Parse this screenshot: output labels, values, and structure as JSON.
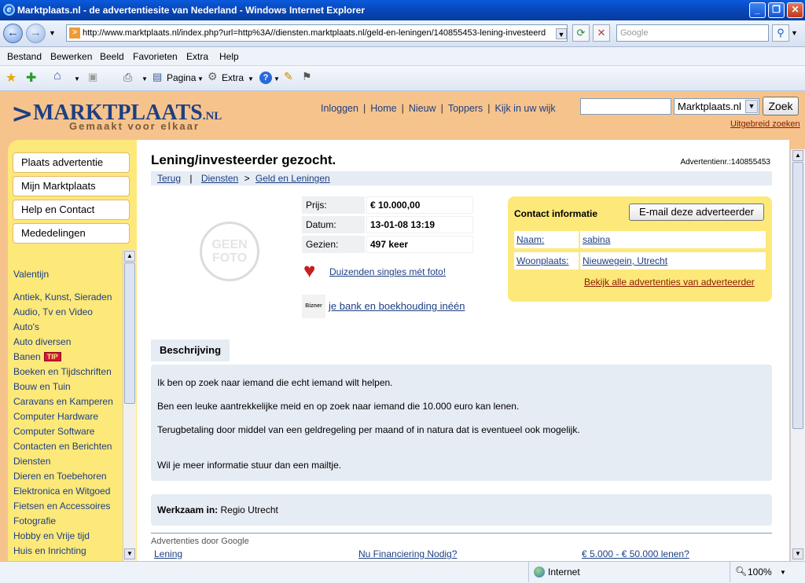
{
  "window": {
    "title": "Marktplaats.nl - de advertentiesite van Nederland - Windows Internet Explorer",
    "address": "http://www.marktplaats.nl/index.php?url=http%3A//diensten.marktplaats.nl/geld-en-leningen/140855453-lening-investeerd",
    "search_placeholder": "Google",
    "menu": [
      "Bestand",
      "Bewerken",
      "Beeld",
      "Favorieten",
      "Extra",
      "Help"
    ],
    "toolbar": {
      "page": "Pagina",
      "extra": "Extra"
    }
  },
  "header": {
    "logo_name": "MARKTPLAATS",
    "logo_tld": ".NL",
    "slogan": "Gemaakt voor elkaar",
    "nav": [
      "Inloggen",
      "Home",
      "Nieuw",
      "Toppers",
      "Kijk in uw wijk"
    ],
    "search_scope": "Marktplaats.nl",
    "search_button": "Zoek",
    "advanced_search": "Uitgebreid zoeken"
  },
  "sidebar": {
    "buttons": [
      "Plaats advertentie",
      "Mijn Marktplaats",
      "Help en Contact",
      "Mededelingen"
    ],
    "categories": [
      "Valentijn",
      "Antiek, Kunst, Sieraden",
      "Audio, Tv en Video",
      "Auto's",
      "Auto diversen",
      "Banen",
      "Boeken en Tijdschriften",
      "Bouw en Tuin",
      "Caravans en Kamperen",
      "Computer Hardware",
      "Computer Software",
      "Contacten en Berichten",
      "Diensten",
      "Dieren en Toebehoren",
      "Elektronica en Witgoed",
      "Fietsen en Accessoires",
      "Fotografie",
      "Hobby en Vrije tijd",
      "Huis en Inrichting"
    ],
    "tip_label": "TIP"
  },
  "ad": {
    "title": "Lening/investeerder gezocht.",
    "number": "Advertentienr.:140855453",
    "breadcrumb": {
      "back": "Terug",
      "sep": "|",
      "cat1": "Diensten",
      "arrow": ">",
      "cat2": "Geld en Leningen"
    },
    "no_photo_line1": "GEEN",
    "no_photo_line2": "FOTO",
    "fields": [
      {
        "label": "Prijs:",
        "value": "€ 10.000,00"
      },
      {
        "label": "Datum:",
        "value": "13-01-08 13:19"
      },
      {
        "label": "Gezien:",
        "value": "497 keer"
      }
    ],
    "singles_link": "Duizenden singles mét foto!",
    "bizner_logo": "Bizner",
    "bank_link": "je bank en boekhouding inéén",
    "tab": "Beschrijving",
    "description": [
      "Ik ben op zoek naar iemand die echt iemand wilt helpen.",
      "Ben een leuke aantrekkelijke meid en op zoek naar iemand die 10.000 euro kan lenen.",
      "Terugbetaling door middel van een geldregeling per maand of in natura dat is eventueel ook mogelijk.",
      "Wil je meer informatie stuur dan een mailtje."
    ],
    "work_label": "Werkzaam in:",
    "work_value": "Regio Utrecht"
  },
  "contact": {
    "title": "Contact informatie",
    "email_button": "E-mail deze adverteerder",
    "name_label": "Naam:",
    "name_value": "sabina",
    "place_label": "Woonplaats:",
    "place_value": "Nieuwegein, Utrecht",
    "all_ads": "Bekijk alle advertenties van adverteerder"
  },
  "google_ads": {
    "label": "Advertenties door Google",
    "links": [
      "Lening",
      "Nu Financiering Nodig?",
      "€ 5.000 - € 50.000 lenen?"
    ]
  },
  "status": {
    "zone": "Internet",
    "zoom": "100%"
  },
  "colors": {
    "page_bg": "#f6c38d",
    "sidebar_bg": "#fde87a",
    "brand": "#1d3f82",
    "panel": "#e6ecf4"
  }
}
